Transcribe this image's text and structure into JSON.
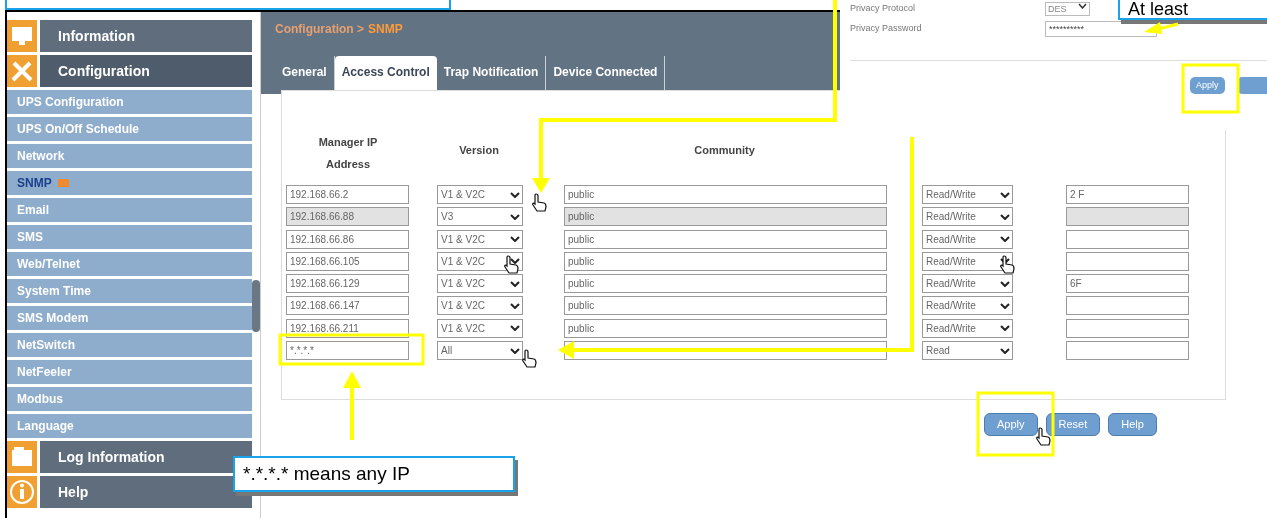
{
  "sidebar": {
    "items": [
      {
        "label": "Information",
        "kind": "section",
        "selected": false
      },
      {
        "label": "Configuration",
        "kind": "section",
        "selected": true
      },
      {
        "label": "UPS Configuration",
        "kind": "subitem",
        "selected": false
      },
      {
        "label": "UPS On/Off Schedule",
        "kind": "subitem",
        "selected": false
      },
      {
        "label": "Network",
        "kind": "subitem",
        "selected": false
      },
      {
        "label": "SNMP",
        "kind": "subitem",
        "selected": true
      },
      {
        "label": "Email",
        "kind": "subitem",
        "selected": false
      },
      {
        "label": "SMS",
        "kind": "subitem",
        "selected": false
      },
      {
        "label": "Web/Telnet",
        "kind": "subitem",
        "selected": false
      },
      {
        "label": "System Time",
        "kind": "subitem",
        "selected": false
      },
      {
        "label": "SMS Modem",
        "kind": "subitem",
        "selected": false
      },
      {
        "label": "NetSwitch",
        "kind": "subitem",
        "selected": false
      },
      {
        "label": "NetFeeler",
        "kind": "subitem",
        "selected": false
      },
      {
        "label": "Modbus",
        "kind": "subitem",
        "selected": false
      },
      {
        "label": "Language",
        "kind": "subitem",
        "selected": false
      },
      {
        "label": "Log Information",
        "kind": "section",
        "selected": false
      },
      {
        "label": "Help",
        "kind": "section",
        "selected": false
      }
    ]
  },
  "breadcrumb": {
    "parent": "Configuration >",
    "current": "SNMP"
  },
  "tabs": [
    {
      "label": "General",
      "selected": false
    },
    {
      "label": "Access Control",
      "selected": true
    },
    {
      "label": "Trap Notification",
      "selected": false
    },
    {
      "label": "Device Connected",
      "selected": false
    }
  ],
  "table": {
    "columns": [
      "Manager IP Address",
      "Version",
      "Community"
    ],
    "rows": [
      {
        "ip": "192.168.66.2",
        "version": "V1 & V2C",
        "community": "public",
        "permission": "Read/Write",
        "description": "2 F",
        "highlighted": false
      },
      {
        "ip": "192.168.66.88",
        "version": "V3",
        "community": "public",
        "permission": "Read/Write",
        "highlighted": true
      },
      {
        "ip": "192.168.66.86",
        "version": "V1 & V2C",
        "community": "public",
        "permission": "Read/Write",
        "highlighted": false
      },
      {
        "ip": "192.168.66.105",
        "version": "V1 & V2C",
        "community": "public",
        "permission": "Read/Write",
        "highlighted": false
      },
      {
        "ip": "192.168.66.129",
        "version": "V1 & V2C",
        "community": "public",
        "permission": "Read/Write",
        "description": "6F",
        "highlighted": false
      },
      {
        "ip": "192.168.66.147",
        "version": "V1 & V2C",
        "community": "public",
        "permission": "Read/Write",
        "highlighted": false
      },
      {
        "ip": "192.168.66.211",
        "version": "V1 & V2C",
        "community": "public",
        "permission": "Read/Write",
        "highlighted": false
      },
      {
        "ip": "*.*.*.*",
        "version": "All",
        "permission": "Read",
        "highlighted": false
      }
    ]
  },
  "buttons": [
    "Apply",
    "Reset",
    "Help"
  ],
  "privacy_panel": {
    "fields": [
      {
        "label": "Privacy Protocol",
        "kind": "select",
        "value": "DES"
      },
      {
        "label": "Privacy Password",
        "kind": "password",
        "value": "**********"
      }
    ],
    "buttons": [
      "Apply"
    ]
  },
  "callouts": [
    "*.*.*.* means any IP",
    "At least"
  ]
}
